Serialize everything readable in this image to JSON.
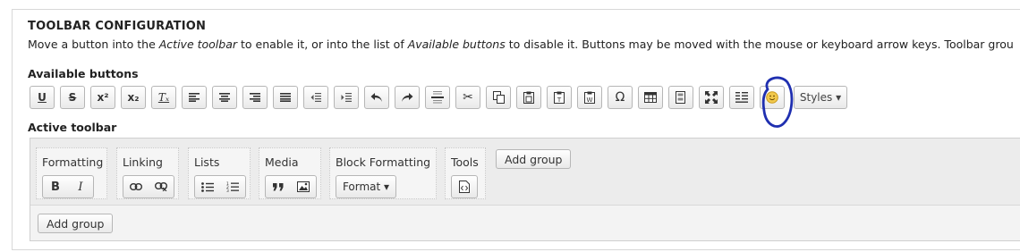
{
  "heading": "TOOLBAR CONFIGURATION",
  "description": {
    "part1": "Move a button into the ",
    "em1": "Active toolbar",
    "part2": " to enable it, or into the list of ",
    "em2": "Available buttons",
    "part3": " to disable it. Buttons may be moved with the mouse or keyboard arrow keys. Toolbar grou"
  },
  "available_label": "Available buttons",
  "available_buttons": [
    {
      "name": "underline-icon",
      "glyph": "U"
    },
    {
      "name": "strikethrough-icon",
      "glyph": "S"
    },
    {
      "name": "superscript-icon",
      "glyph": "x²"
    },
    {
      "name": "subscript-icon",
      "glyph": "x₂"
    },
    {
      "name": "remove-format-icon",
      "glyph": "Tₓ"
    },
    {
      "name": "align-left-icon",
      "glyph": ""
    },
    {
      "name": "align-center-icon",
      "glyph": ""
    },
    {
      "name": "align-right-icon",
      "glyph": ""
    },
    {
      "name": "justify-icon",
      "glyph": ""
    },
    {
      "name": "outdent-icon",
      "glyph": ""
    },
    {
      "name": "indent-icon",
      "glyph": ""
    },
    {
      "name": "undo-icon",
      "glyph": "↶"
    },
    {
      "name": "redo-icon",
      "glyph": "↷"
    },
    {
      "name": "horizontal-rule-icon",
      "glyph": ""
    },
    {
      "name": "cut-icon",
      "glyph": "✂"
    },
    {
      "name": "copy-icon",
      "glyph": ""
    },
    {
      "name": "paste-icon",
      "glyph": ""
    },
    {
      "name": "paste-text-icon",
      "glyph": ""
    },
    {
      "name": "paste-word-icon",
      "glyph": ""
    },
    {
      "name": "special-char-icon",
      "glyph": "Ω"
    },
    {
      "name": "table-icon",
      "glyph": ""
    },
    {
      "name": "show-blocks-icon",
      "glyph": ""
    },
    {
      "name": "maximize-icon",
      "glyph": ""
    },
    {
      "name": "source-icon",
      "glyph": ""
    },
    {
      "name": "smiley-icon",
      "glyph": ""
    }
  ],
  "styles_label": "Styles ▾",
  "active_label": "Active toolbar",
  "groups": [
    {
      "name": "Formatting",
      "buttons": [
        "B",
        "I"
      ]
    },
    {
      "name": "Linking",
      "buttons": [
        "link",
        "unlink"
      ]
    },
    {
      "name": "Lists",
      "buttons": [
        "bullets",
        "numbers"
      ]
    },
    {
      "name": "Media",
      "buttons": [
        "quote",
        "image"
      ]
    },
    {
      "name": "Block Formatting",
      "buttons": [
        "Format ▾"
      ]
    },
    {
      "name": "Tools",
      "buttons": [
        "source"
      ]
    }
  ],
  "add_group_label": "Add group",
  "colors": {
    "annotation": "#1f2fb0",
    "accent": "#333333"
  }
}
